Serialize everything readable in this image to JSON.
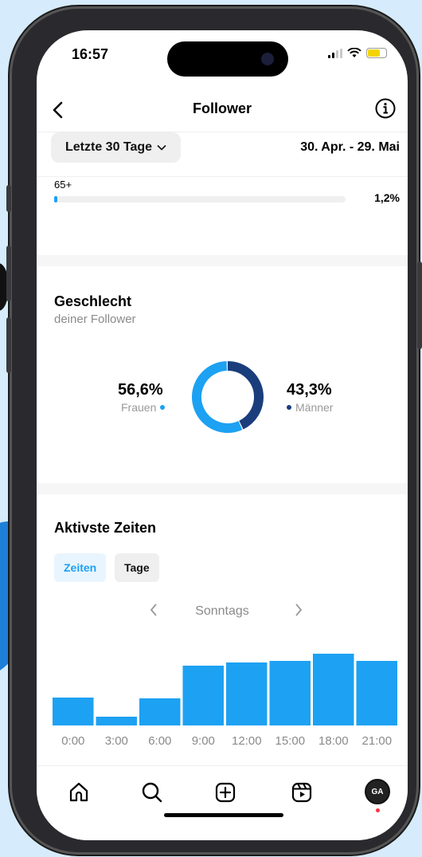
{
  "status_bar": {
    "time": "16:57"
  },
  "header": {
    "title": "Follower"
  },
  "range": {
    "selector_label": "Letzte 30 Tage",
    "dates": "30. Apr. - 29. Mai"
  },
  "age": {
    "label": "65+",
    "value": "1,2%",
    "fraction": 0.012
  },
  "gender": {
    "title": "Geschlecht",
    "subtitle": "deiner Follower",
    "women": {
      "pct": "56,6%",
      "label": "Frauen",
      "value": 56.6,
      "color": "#1da1f2"
    },
    "men": {
      "pct": "43,3%",
      "label": "Männer",
      "value": 43.3,
      "color": "#1a3d7c"
    }
  },
  "active_times": {
    "title": "Aktivste Zeiten",
    "tabs": [
      {
        "label": "Zeiten",
        "active": true
      },
      {
        "label": "Tage",
        "active": false
      }
    ],
    "day_label": "Sonntags"
  },
  "chart_data": {
    "type": "bar",
    "categories": [
      "0:00",
      "3:00",
      "6:00",
      "9:00",
      "12:00",
      "15:00",
      "18:00",
      "21:00"
    ],
    "values": [
      35,
      11,
      34,
      75,
      79,
      81,
      90,
      81
    ],
    "color": "#1da1f2",
    "title": "",
    "xlabel": "",
    "ylabel": ""
  },
  "tabbar": {
    "icons": [
      "home-icon",
      "search-icon",
      "create-icon",
      "reels-icon"
    ],
    "avatar_initials": "GA"
  }
}
